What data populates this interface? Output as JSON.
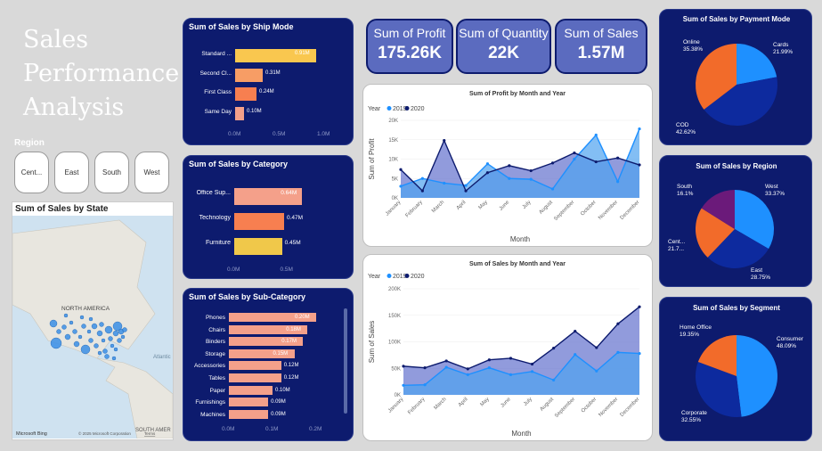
{
  "title": "Sales Performance Analysis",
  "region_slicer": {
    "label": "Region",
    "options": [
      "Cent...",
      "East",
      "South",
      "West"
    ]
  },
  "map": {
    "title": "Sum of Sales by State",
    "labels": {
      "north_america": "NORTH AMERICA",
      "atlantic": "Atlantic",
      "south_america": "SOUTH AMER",
      "bing": "Microsoft Bing",
      "copyright": "© 2025 Microsoft Corporation",
      "terms": "Terms"
    }
  },
  "ship_mode": {
    "title": "Sum of Sales by Ship Mode",
    "categories": [
      "Standard ...",
      "Second Cl...",
      "First Class",
      "Same Day"
    ],
    "values": [
      0.91,
      0.31,
      0.24,
      0.1
    ],
    "labels": [
      "0.91M",
      "0.31M",
      "0.24M",
      "0.10M"
    ],
    "colors": [
      "#f9c74f",
      "#f79d65",
      "#f77f50",
      "#f4a08a"
    ],
    "axis": [
      "0.0M",
      "0.5M",
      "1.0M"
    ]
  },
  "category": {
    "title": "Sum of Sales by Category",
    "categories": [
      "Office Sup...",
      "Technology",
      "Furniture"
    ],
    "values": [
      0.64,
      0.47,
      0.45
    ],
    "labels": [
      "0.64M",
      "0.47M",
      "0.45M"
    ],
    "colors": [
      "#f4a08a",
      "#f77f50",
      "#f0c84a"
    ],
    "axis": [
      "0.0M",
      "0.5M"
    ]
  },
  "sub_category": {
    "title": "Sum of Sales by Sub-Category",
    "categories": [
      "Phones",
      "Chairs",
      "Binders",
      "Storage",
      "Accessories",
      "Tables",
      "Paper",
      "Furnishings",
      "Machines"
    ],
    "values": [
      0.2,
      0.18,
      0.17,
      0.15,
      0.12,
      0.12,
      0.1,
      0.09,
      0.09
    ],
    "labels": [
      "0.20M",
      "0.18M",
      "0.17M",
      "0.15M",
      "0.12M",
      "0.12M",
      "0.10M",
      "0.09M",
      "0.09M"
    ],
    "axis": [
      "0.0M",
      "0.1M",
      "0.2M"
    ]
  },
  "kpis": [
    {
      "label": "Sum of Profit",
      "value": "175.26K"
    },
    {
      "label": "Sum of Quantity",
      "value": "22K"
    },
    {
      "label": "Sum of Sales",
      "value": "1.57M"
    }
  ],
  "chart_data": [
    {
      "type": "area",
      "title": "Sum of Profit by Month and Year",
      "xlabel": "Month",
      "ylabel": "Sum of Profit",
      "legend_title": "Year",
      "categories": [
        "January",
        "February",
        "March",
        "April",
        "May",
        "June",
        "July",
        "August",
        "September",
        "October",
        "November",
        "December"
      ],
      "yticks": [
        "0K",
        "5K",
        "10K",
        "15K",
        "20K"
      ],
      "ylim": [
        0,
        20000
      ],
      "series": [
        {
          "name": "2019",
          "color": "#1e90ff",
          "values": [
            3000,
            5000,
            3800,
            3200,
            8800,
            5000,
            4800,
            2300,
            10000,
            16200,
            4200,
            17800
          ]
        },
        {
          "name": "2020",
          "color": "#0d1b6e",
          "values": [
            7300,
            1800,
            14800,
            1800,
            6500,
            8300,
            7000,
            9000,
            11600,
            9300,
            10300,
            8500
          ]
        }
      ]
    },
    {
      "type": "area",
      "title": "Sum of Sales by Month and Year",
      "xlabel": "Month",
      "ylabel": "Sum of Sales",
      "legend_title": "Year",
      "categories": [
        "January",
        "February",
        "March",
        "April",
        "May",
        "June",
        "July",
        "August",
        "September",
        "October",
        "November",
        "December"
      ],
      "yticks": [
        "0K",
        "50K",
        "100K",
        "150K",
        "200K"
      ],
      "ylim": [
        0,
        200000
      ],
      "series": [
        {
          "name": "2019",
          "color": "#1e90ff",
          "values": [
            18000,
            19000,
            52000,
            38000,
            51000,
            38000,
            44000,
            28000,
            76000,
            45000,
            80000,
            78000
          ]
        },
        {
          "name": "2020",
          "color": "#0d1b6e",
          "values": [
            54000,
            51000,
            64000,
            49000,
            66000,
            69000,
            58000,
            88000,
            120000,
            89000,
            134000,
            166000
          ]
        }
      ]
    },
    {
      "type": "pie",
      "title": "Sum of Sales by Payment Mode",
      "slices": [
        {
          "label": "Cards",
          "pct": "21.99%",
          "value": 21.99,
          "color": "#1e90ff"
        },
        {
          "label": "COD",
          "pct": "42.62%",
          "value": 42.62,
          "color": "#0d2a9e"
        },
        {
          "label": "Online",
          "pct": "35.38%",
          "value": 35.38,
          "color": "#f26b2a"
        }
      ]
    },
    {
      "type": "pie",
      "title": "Sum of Sales by Region",
      "slices": [
        {
          "label": "West",
          "pct": "33.37%",
          "value": 33.37,
          "color": "#1e90ff"
        },
        {
          "label": "East",
          "pct": "28.75%",
          "value": 28.75,
          "color": "#0d2a9e"
        },
        {
          "label": "Cent...",
          "pct": "21.7...",
          "value": 21.78,
          "color": "#f26b2a"
        },
        {
          "label": "South",
          "pct": "16.1%",
          "value": 16.1,
          "color": "#6b1a7a"
        }
      ]
    },
    {
      "type": "pie",
      "title": "Sum of Sales by Segment",
      "slices": [
        {
          "label": "Consumer",
          "pct": "48.09%",
          "value": 48.09,
          "color": "#1e90ff"
        },
        {
          "label": "Corporate",
          "pct": "32.55%",
          "value": 32.55,
          "color": "#0d2a9e"
        },
        {
          "label": "Home Office",
          "pct": "19.35%",
          "value": 19.35,
          "color": "#f26b2a"
        }
      ]
    }
  ]
}
